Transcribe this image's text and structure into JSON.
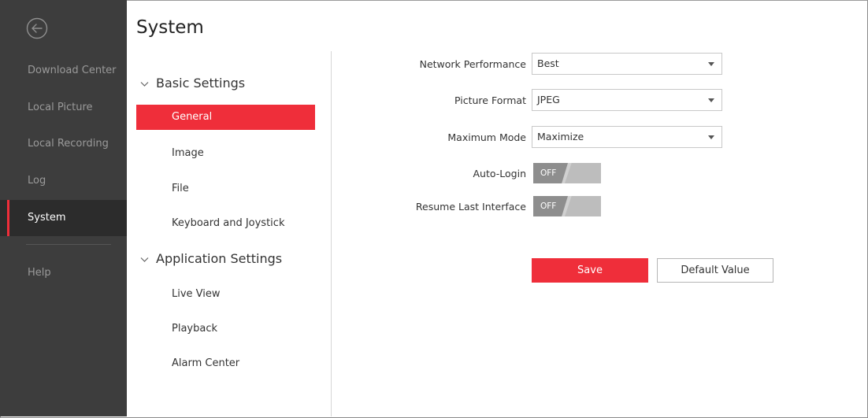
{
  "sidebar": {
    "back_icon": "back-arrow-icon",
    "items": [
      {
        "label": "Download Center"
      },
      {
        "label": "Local Picture"
      },
      {
        "label": "Local Recording"
      },
      {
        "label": "Log"
      },
      {
        "label": "System",
        "active": true
      },
      {
        "label": "Help"
      }
    ]
  },
  "page": {
    "title": "System"
  },
  "settings_nav": {
    "groups": [
      {
        "label": "Basic Settings",
        "items": [
          "General",
          "Image",
          "File",
          "Keyboard and Joystick"
        ]
      },
      {
        "label": "Application Settings",
        "items": [
          "Live View",
          "Playback",
          "Alarm Center"
        ]
      }
    ],
    "active_item": "General"
  },
  "form": {
    "network_performance": {
      "label": "Network Performance",
      "value": "Best"
    },
    "picture_format": {
      "label": "Picture Format",
      "value": "JPEG"
    },
    "maximum_mode": {
      "label": "Maximum Mode",
      "value": "Maximize"
    },
    "auto_login": {
      "label": "Auto-Login",
      "state": "OFF"
    },
    "resume_last_interface": {
      "label": "Resume Last Interface",
      "state": "OFF"
    }
  },
  "buttons": {
    "save": "Save",
    "default_value": "Default Value"
  },
  "colors": {
    "accent": "#ef2e3a",
    "sidebar_bg": "#3d3d3d",
    "sidebar_active_bg": "#2c2c2c"
  }
}
